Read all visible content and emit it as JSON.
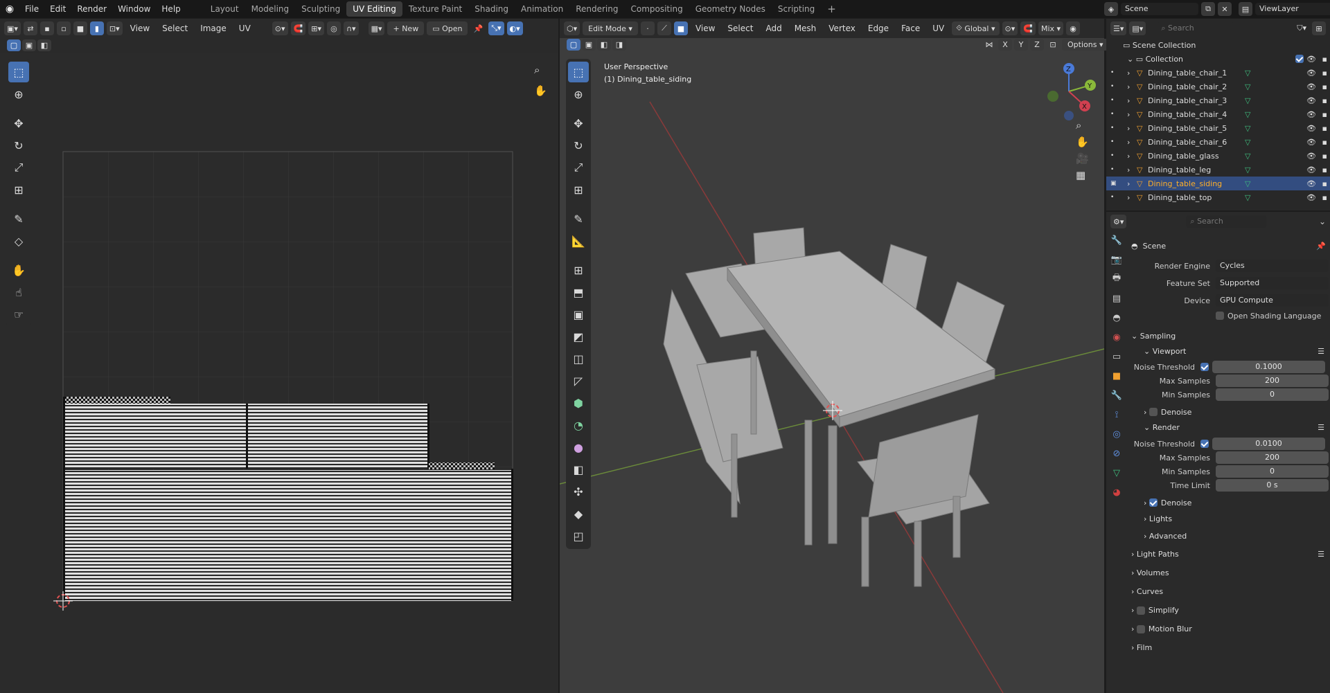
{
  "menu": [
    "File",
    "Edit",
    "Render",
    "Window",
    "Help"
  ],
  "workspaces": [
    "Layout",
    "Modeling",
    "Sculpting",
    "UV Editing",
    "Texture Paint",
    "Shading",
    "Animation",
    "Rendering",
    "Compositing",
    "Geometry Nodes",
    "Scripting"
  ],
  "active_workspace": "UV Editing",
  "scene_name": "Scene",
  "view_layer": "ViewLayer",
  "uv_editor": {
    "menus": [
      "View",
      "Select",
      "Image",
      "UV"
    ],
    "new_label": "New",
    "open_label": "Open"
  },
  "viewport": {
    "mode": "Edit Mode",
    "menus": [
      "View",
      "Select",
      "Add",
      "Mesh",
      "Vertex",
      "Edge",
      "Face",
      "UV"
    ],
    "orientation": "Global",
    "snap": "Mix",
    "options_label": "Options",
    "overlay_line1": "User Perspective",
    "overlay_line2": "(1) Dining_table_siding",
    "axes": {
      "x": "X",
      "y": "Y",
      "z": "Z"
    },
    "axis_buttons": [
      "X",
      "Y",
      "Z"
    ]
  },
  "outliner": {
    "search_placeholder": "Search",
    "root": "Scene Collection",
    "collection": "Collection",
    "items": [
      "Dining_table_chair_1",
      "Dining_table_chair_2",
      "Dining_table_chair_3",
      "Dining_table_chair_4",
      "Dining_table_chair_5",
      "Dining_table_chair_6",
      "Dining_table_glass",
      "Dining_table_leg",
      "Dining_table_siding",
      "Dining_table_top"
    ],
    "selected": "Dining_table_siding"
  },
  "properties": {
    "search_placeholder": "Search",
    "title": "Scene",
    "render_engine_label": "Render Engine",
    "render_engine": "Cycles",
    "feature_set_label": "Feature Set",
    "feature_set": "Supported",
    "device_label": "Device",
    "device": "GPU Compute",
    "osl_label": "Open Shading Language",
    "sampling": "Sampling",
    "viewport": "Viewport",
    "render": "Render",
    "noise_threshold_label": "Noise Threshold",
    "max_samples_label": "Max Samples",
    "min_samples_label": "Min Samples",
    "time_limit_label": "Time Limit",
    "denoise_label": "Denoise",
    "vp_noise": "0.1000",
    "vp_max": "200",
    "vp_min": "0",
    "r_noise": "0.0100",
    "r_max": "200",
    "r_min": "0",
    "r_time": "0 s",
    "lights": "Lights",
    "advanced": "Advanced",
    "light_paths": "Light Paths",
    "volumes": "Volumes",
    "curves": "Curves",
    "simplify": "Simplify",
    "motion_blur": "Motion Blur",
    "film": "Film"
  },
  "colors": {
    "accent": "#4772b3",
    "selected_text": "#ffaf29",
    "bg": "#1d1d1d",
    "panel": "#2a2a2a"
  }
}
